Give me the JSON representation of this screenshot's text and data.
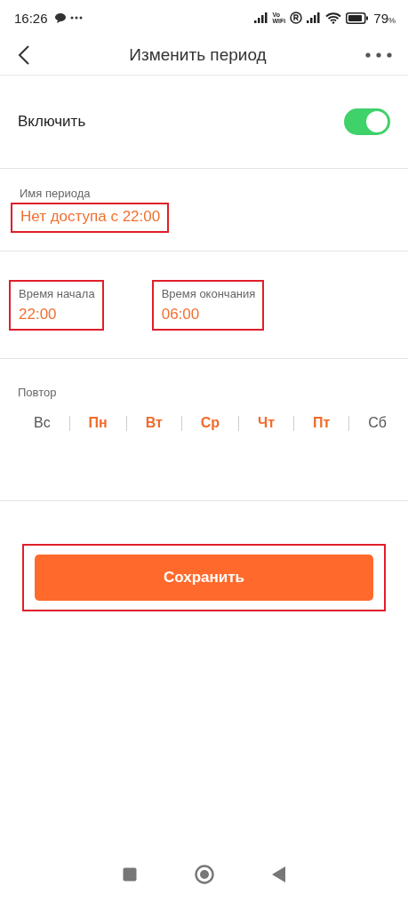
{
  "status_bar": {
    "time": "16:26",
    "battery": "79",
    "battery_unit": "%",
    "volte": [
      "Vo",
      "WiFi"
    ]
  },
  "header": {
    "title": "Изменить период"
  },
  "enable": {
    "label": "Включить",
    "on": true
  },
  "period_name": {
    "label": "Имя периода",
    "value": "Нет доступа с 22:00",
    "highlighted": true
  },
  "times": [
    {
      "label": "Время начала",
      "value": "22:00",
      "highlighted": true
    },
    {
      "label": "Время окончания",
      "value": "06:00",
      "highlighted": true
    }
  ],
  "repeat": {
    "label": "Повтор",
    "days": [
      {
        "label": "Вс",
        "selected": false
      },
      {
        "label": "Пн",
        "selected": true
      },
      {
        "label": "Вт",
        "selected": true
      },
      {
        "label": "Ср",
        "selected": true
      },
      {
        "label": "Чт",
        "selected": true
      },
      {
        "label": "Пт",
        "selected": true
      },
      {
        "label": "Сб",
        "selected": false
      }
    ]
  },
  "save_button": {
    "label": "Сохранить",
    "highlighted": true
  }
}
